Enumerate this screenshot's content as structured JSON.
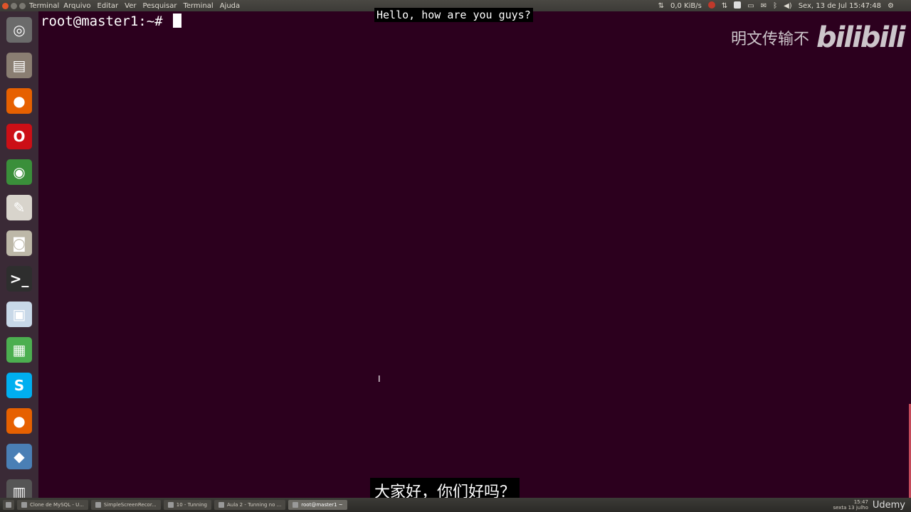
{
  "window": {
    "app_name": "Terminal"
  },
  "menu": [
    "Arquivo",
    "Editar",
    "Ver",
    "Pesquisar",
    "Terminal",
    "Ajuda"
  ],
  "indicators": {
    "network_speed": "0,0 KiB/s",
    "datetime": "Sex, 13 de Jul 15:47:48"
  },
  "terminal": {
    "prompt": "root@master1:~# "
  },
  "subtitles": {
    "top": "Hello, how are you guys?",
    "bottom": "大家好，你们好吗？"
  },
  "watermark": {
    "text": "明文传输不",
    "brand": "bilibili"
  },
  "launcher": [
    {
      "name": "ubuntu-dash-icon",
      "color": "#6b6b6b",
      "glyph": "◎"
    },
    {
      "name": "files-icon",
      "color": "#8a7e72",
      "glyph": "▤"
    },
    {
      "name": "firefox-icon",
      "color": "#e66000",
      "glyph": "●"
    },
    {
      "name": "opera-icon",
      "color": "#cc0f16",
      "glyph": "O"
    },
    {
      "name": "chrome-icon",
      "color": "#3a8f3a",
      "glyph": "◉"
    },
    {
      "name": "text-editor-icon",
      "color": "#d8d4cc",
      "glyph": "✎"
    },
    {
      "name": "rhythmbox-icon",
      "color": "#bdb8a8",
      "glyph": "◙"
    },
    {
      "name": "terminal-icon",
      "color": "#2e2e2e",
      "glyph": ">_"
    },
    {
      "name": "image-viewer-icon",
      "color": "#c8d8e8",
      "glyph": "▣"
    },
    {
      "name": "spreadsheet-icon",
      "color": "#4caf50",
      "glyph": "▦"
    },
    {
      "name": "skype-icon",
      "color": "#00aff0",
      "glyph": "S"
    },
    {
      "name": "firefox-icon-2",
      "color": "#e66000",
      "glyph": "●"
    },
    {
      "name": "virtualbox-icon",
      "color": "#4a7fb5",
      "glyph": "◆"
    },
    {
      "name": "workspace-switcher-icon",
      "color": "#555",
      "glyph": "▥"
    }
  ],
  "taskbar": {
    "tasks": [
      {
        "label": "Clone de MySQL - U...",
        "active": false
      },
      {
        "label": "SimpleScreenRecor...",
        "active": false
      },
      {
        "label": "10 - Tunning",
        "active": false
      },
      {
        "label": "Aula 2 - Tunning no ...",
        "active": false
      },
      {
        "label": "root@master1 ~",
        "active": true
      }
    ],
    "clock_time": "15:47",
    "clock_date": "sexta 13 julho",
    "brand": "Udemy"
  }
}
